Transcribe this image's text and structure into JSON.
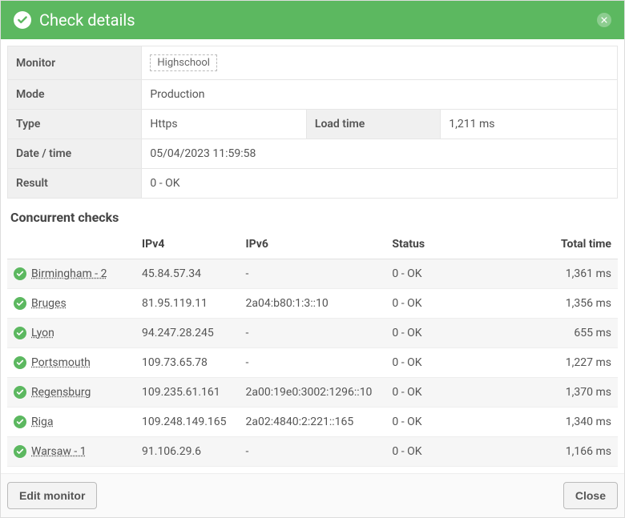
{
  "header": {
    "title": "Check details"
  },
  "details": {
    "monitor_label": "Monitor",
    "monitor_value": "Highschool",
    "mode_label": "Mode",
    "mode_value": "Production",
    "type_label": "Type",
    "type_value": "Https",
    "loadtime_label": "Load time",
    "loadtime_value": "1,211 ms",
    "datetime_label": "Date / time",
    "datetime_value": "05/04/2023 11:59:58",
    "result_label": "Result",
    "result_value": "0 - OK"
  },
  "concurrent": {
    "title": "Concurrent checks",
    "columns": {
      "location": "",
      "ipv4": "IPv4",
      "ipv6": "IPv6",
      "status": "Status",
      "total_time": "Total time"
    },
    "rows": [
      {
        "location": "Birmingham - 2",
        "ipv4": "45.84.57.34",
        "ipv6": "-",
        "status": "0 - OK",
        "total_time": "1,361 ms"
      },
      {
        "location": "Bruges",
        "ipv4": "81.95.119.11",
        "ipv6": "2a04:b80:1:3::10",
        "status": "0 - OK",
        "total_time": "1,356 ms"
      },
      {
        "location": "Lyon",
        "ipv4": "94.247.28.245",
        "ipv6": "-",
        "status": "0 - OK",
        "total_time": "655 ms"
      },
      {
        "location": "Portsmouth",
        "ipv4": "109.73.65.78",
        "ipv6": "-",
        "status": "0 - OK",
        "total_time": "1,227 ms"
      },
      {
        "location": "Regensburg",
        "ipv4": "109.235.61.161",
        "ipv6": "2a00:19e0:3002:1296::10",
        "status": "0 - OK",
        "total_time": "1,370 ms"
      },
      {
        "location": "Riga",
        "ipv4": "109.248.149.165",
        "ipv6": "2a02:4840:2:221::165",
        "status": "0 - OK",
        "total_time": "1,340 ms"
      },
      {
        "location": "Warsaw - 1",
        "ipv4": "91.106.29.6",
        "ipv6": "-",
        "status": "0 - OK",
        "total_time": "1,166 ms"
      }
    ]
  },
  "footer": {
    "edit_label": "Edit monitor",
    "close_label": "Close"
  }
}
